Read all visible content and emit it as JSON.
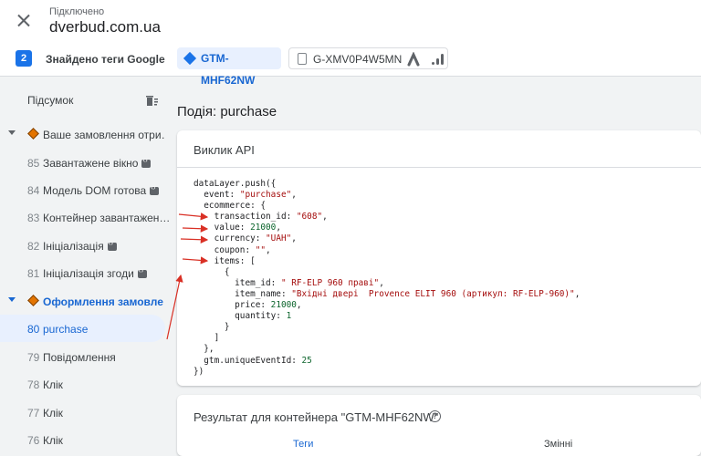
{
  "header": {
    "connection_status": "Підключено",
    "domain": "dverbud.com.ua"
  },
  "tag_bar": {
    "count": "2",
    "found_label": "Знайдено теги Google",
    "chips": [
      {
        "label": "GTM-MHF62NW",
        "icon": "gtm-diamond-icon",
        "active": true
      },
      {
        "label": "G-XMV0P4W5MN",
        "icon": "shopping-bag-icon",
        "active": false
      }
    ]
  },
  "sidebar": {
    "summary_label": "Підсумок",
    "groups": [
      {
        "label": "Ваше замовлення отри…",
        "expanded": true,
        "items": [
          {
            "num": "85",
            "label": "Завантажене вікно"
          },
          {
            "num": "84",
            "label": "Модель DOM готова"
          },
          {
            "num": "83",
            "label": "Контейнер завантажен…"
          },
          {
            "num": "82",
            "label": "Ініціалізація"
          },
          {
            "num": "81",
            "label": "Ініціалізація згоди"
          }
        ]
      },
      {
        "label": "Оформлення замовле…",
        "expanded": true,
        "items": [
          {
            "num": "80",
            "label": "purchase",
            "selected": true
          },
          {
            "num": "79",
            "label": "Повідомлення"
          },
          {
            "num": "78",
            "label": "Клік"
          },
          {
            "num": "77",
            "label": "Клік"
          },
          {
            "num": "76",
            "label": "Клік"
          }
        ]
      }
    ]
  },
  "main": {
    "event_title": "Подія: purchase",
    "api_card_title": "Виклик API",
    "code_lines": [
      "dataLayer.push({",
      "  event: \"purchase\",",
      "  ecommerce: {",
      "    transaction_id: \"608\",",
      "    value: 21000,",
      "    currency: \"UAH\",",
      "    coupon: \"\",",
      "    items: [",
      "      {",
      "        item_id: \" RF-ELP 960 праві\",",
      "        item_name: \"Вхідні двері  Provence ELIT 960 (артикул: RF-ELP-960)\",",
      "        price: 21000,",
      "        quantity: 1",
      "      }",
      "    ]",
      "  },",
      "  gtm.uniqueEventId: 25",
      "})"
    ],
    "result_title": "Результат для контейнера \"GTM-MHF62NW\"",
    "result_tabs": [
      "Теги",
      "Змінні"
    ]
  },
  "colors": {
    "accent": "#1a73e8",
    "selected_bg": "#e8f0fe",
    "tag_diamond": "#e37400",
    "annotation_arrow": "#d93025"
  }
}
